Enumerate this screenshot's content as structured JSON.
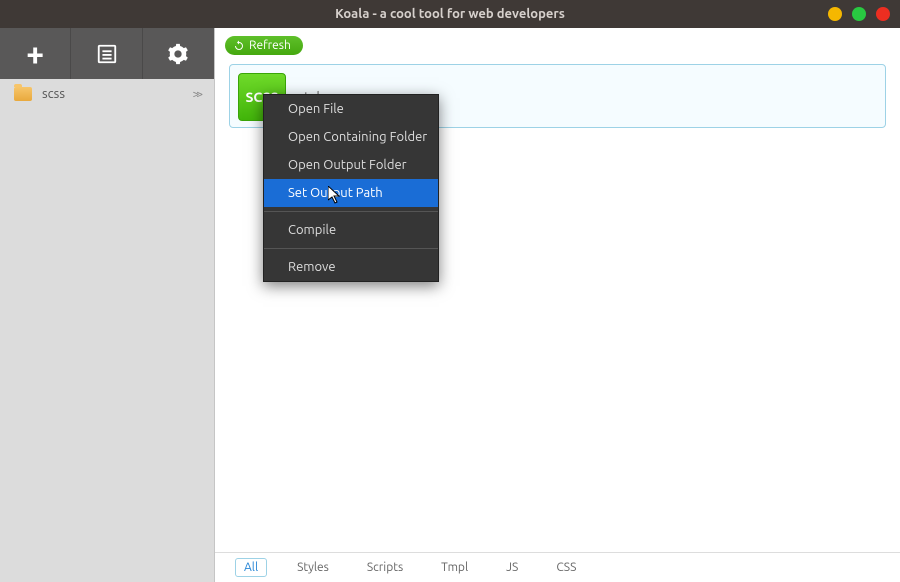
{
  "titlebar": {
    "title": "Koala - a cool tool for web developers"
  },
  "sidebar": {
    "folder": {
      "label": "scss"
    }
  },
  "main": {
    "refresh_label": "Refresh",
    "file": {
      "badge": "SCSS",
      "name": "style.scss"
    }
  },
  "context_menu": {
    "items": [
      {
        "label": "Open File"
      },
      {
        "label": "Open Containing Folder"
      },
      {
        "label": "Open Output Folder"
      },
      {
        "label": "Set Output Path",
        "highlight": true
      },
      {
        "sep": true
      },
      {
        "label": "Compile"
      },
      {
        "sep": true
      },
      {
        "label": "Remove"
      }
    ]
  },
  "footer": {
    "items": [
      {
        "label": "All",
        "active": true
      },
      {
        "label": "Styles"
      },
      {
        "label": "Scripts"
      },
      {
        "label": "Tmpl"
      },
      {
        "label": "JS"
      },
      {
        "label": "CSS"
      }
    ]
  }
}
